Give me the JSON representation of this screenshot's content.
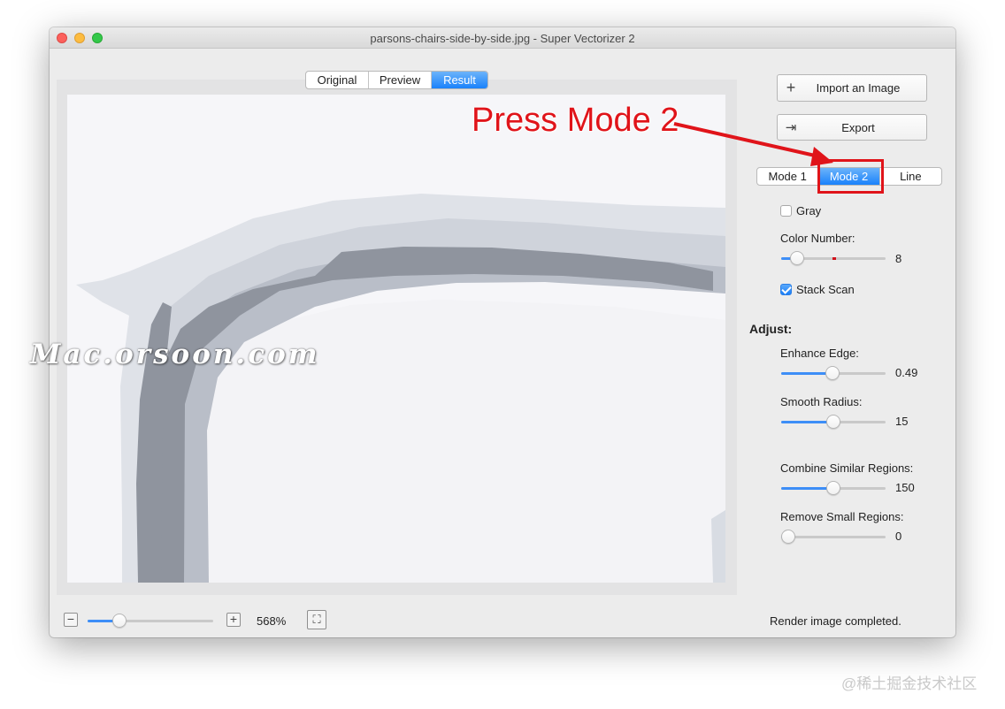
{
  "window": {
    "title": "parsons-chairs-side-by-side.jpg - Super Vectorizer 2"
  },
  "view_tabs": [
    {
      "label": "Original",
      "active": false
    },
    {
      "label": "Preview",
      "active": false
    },
    {
      "label": "Result",
      "active": true
    }
  ],
  "actions": {
    "import_label": "Import an Image",
    "import_icon": "plus-icon",
    "export_label": "Export",
    "export_icon": "export-icon"
  },
  "mode_tabs": [
    {
      "label": "Mode 1",
      "active": false
    },
    {
      "label": "Mode 2",
      "active": true
    },
    {
      "label": "Line",
      "active": false
    }
  ],
  "options": {
    "gray_label": "Gray",
    "gray_checked": false,
    "color_number_label": "Color Number:",
    "color_number_value": "8",
    "color_number_level": 0.15,
    "stack_scan_label": "Stack Scan",
    "stack_scan_checked": true
  },
  "adjust": {
    "heading": "Adjust:",
    "enhance_edge_label": "Enhance Edge:",
    "enhance_edge_value": "0.49",
    "enhance_edge_level": 0.49,
    "smooth_radius_label": "Smooth Radius:",
    "smooth_radius_value": "15",
    "smooth_radius_level": 0.5,
    "combine_label": "Combine Similar Regions:",
    "combine_value": "150",
    "combine_level": 0.5,
    "remove_label": "Remove Small Regions:",
    "remove_value": "0",
    "remove_level": 0.0
  },
  "bottom_bar": {
    "zoom_out_icon": "minus-icon",
    "zoom_in_icon": "plus-icon",
    "zoom_level": "568%",
    "zoom_level_fraction": 0.25,
    "fit_icon": "fullscreen-icon",
    "status": "Render image completed."
  },
  "annotation": {
    "text": "Press Mode 2",
    "color": "#e0141a"
  },
  "watermark": "Mac.orsoon.com",
  "credit": "@稀土掘金技术社区",
  "colors": {
    "accent": "#1a82fb",
    "annotation_red": "#e0141a"
  }
}
